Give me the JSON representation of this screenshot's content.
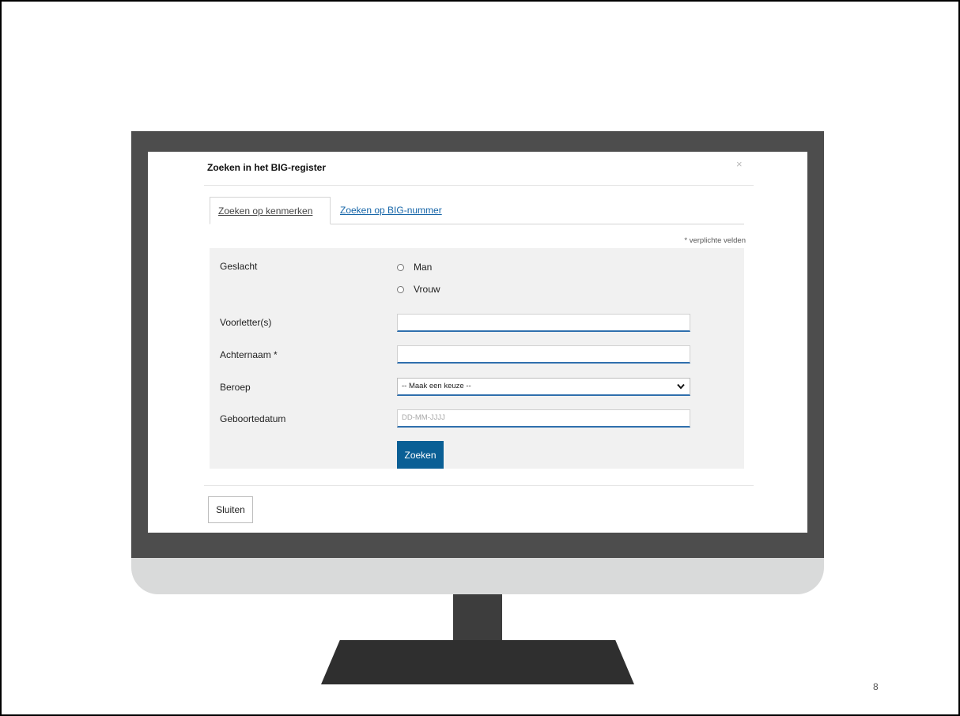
{
  "modal": {
    "title": "Zoeken in het BIG-register",
    "close_glyph": "×"
  },
  "tabs": [
    {
      "label": "Zoeken op kenmerken",
      "active": true
    },
    {
      "label": "Zoeken op BIG-nummer",
      "active": false
    }
  ],
  "form": {
    "required_note": "* verplichte velden",
    "gender": {
      "label": "Geslacht",
      "options": [
        "Man",
        "Vrouw"
      ]
    },
    "initials": {
      "label": "Voorletter(s)",
      "value": ""
    },
    "surname": {
      "label": "Achternaam *",
      "value": ""
    },
    "profession": {
      "label": "Beroep",
      "selected": "-- Maak een keuze --"
    },
    "birthdate": {
      "label": "Geboortedatum",
      "placeholder": "DD-MM-JJJJ"
    },
    "search_label": "Zoeken"
  },
  "footer": {
    "close_label": "Sluiten"
  },
  "slide": {
    "number": "8"
  },
  "colors": {
    "accent": "#0a5f95",
    "link": "#1565a8",
    "panel": "#f1f1f1",
    "bezel": "#4d4d4d"
  },
  "icons": {
    "close": "close-icon",
    "dropdown": "chevron-down-icon",
    "radio": "radio-circle"
  }
}
